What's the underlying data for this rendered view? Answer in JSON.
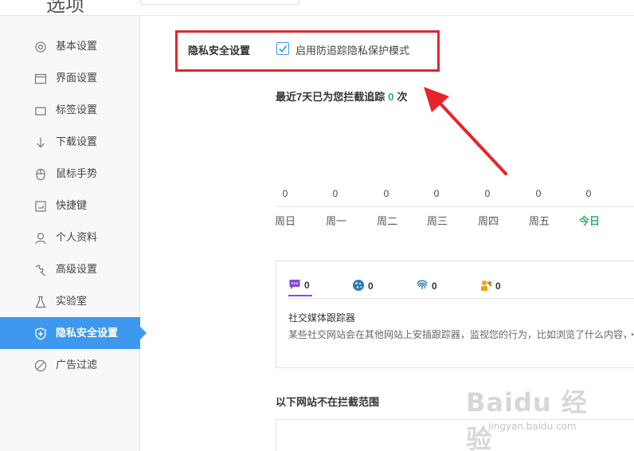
{
  "header": {
    "title": "选项",
    "search_placeholder": ""
  },
  "sidebar": {
    "items": [
      {
        "label": "基本设置",
        "icon": "settings-gear-icon"
      },
      {
        "label": "界面设置",
        "icon": "window-icon"
      },
      {
        "label": "标签设置",
        "icon": "tab-icon"
      },
      {
        "label": "下载设置",
        "icon": "download-icon"
      },
      {
        "label": "鼠标手势",
        "icon": "mouse-icon"
      },
      {
        "label": "快捷键",
        "icon": "keyboard-icon"
      },
      {
        "label": "个人资料",
        "icon": "user-icon"
      },
      {
        "label": "高级设置",
        "icon": "wrench-icon"
      },
      {
        "label": "实验室",
        "icon": "flask-icon"
      },
      {
        "label": "隐私安全设置",
        "icon": "shield-icon",
        "active": true
      },
      {
        "label": "广告过滤",
        "icon": "block-icon"
      }
    ]
  },
  "privacy": {
    "title": "隐私安全设置",
    "checkbox_label": "启用防追踪隐私保护模式",
    "checked": true
  },
  "stats": {
    "prefix": "最近7天已为您拦截追踪",
    "count": "0",
    "suffix": "次",
    "counts": [
      "0",
      "0",
      "0",
      "0",
      "0",
      "0",
      "0"
    ],
    "days": [
      "周日",
      "周一",
      "周二",
      "周三",
      "周四",
      "周五",
      "今日"
    ]
  },
  "trackers": {
    "tabs": [
      {
        "icon": "social-chat-icon",
        "count": "0",
        "active": true
      },
      {
        "icon": "cookie-icon",
        "count": "0"
      },
      {
        "icon": "fingerprint-icon",
        "count": "0"
      },
      {
        "icon": "miner-icon",
        "count": "0"
      }
    ],
    "name": "社交媒体跟踪器",
    "description": "某些社交网站会在其他网站上安插跟踪器，监视您的行为，比如浏览了什么内容，・"
  },
  "exclusions": {
    "title": "以下网站不在拦截范围"
  },
  "watermark": {
    "main": "Baidu 经验",
    "sub": "jingyan.baidu.com"
  },
  "colors": {
    "accent": "#3d98ee",
    "highlight_red": "#e0282b",
    "green": "#2bb36a",
    "purple": "#8a4bd6"
  }
}
